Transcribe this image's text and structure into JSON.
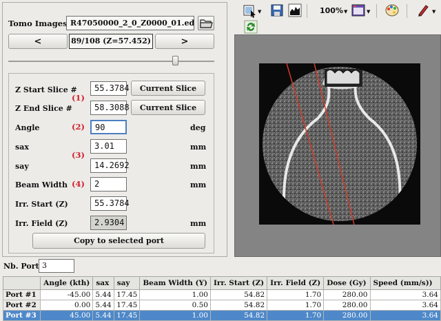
{
  "tomo": {
    "label": "Tomo Images",
    "file": "R47050000_2_0_Z0000_01.edf",
    "prev_label": "<",
    "next_label": ">",
    "slice_position": "89/108 (Z=57.452)",
    "slider_fraction": 0.82
  },
  "form": {
    "z_start": {
      "label": "Z Start Slice #",
      "value": "55.3784",
      "button": "Current Slice"
    },
    "z_end": {
      "label": "Z End Slice #",
      "value": "58.3088",
      "button": "Current Slice"
    },
    "group1": "(1)",
    "angle": {
      "label": "Angle",
      "value": "90",
      "unit": "deg",
      "marker": "(2)"
    },
    "sax": {
      "label": "sax",
      "value": "3.01",
      "unit": "mm"
    },
    "say": {
      "label": "say",
      "value": "14.2692",
      "unit": "mm"
    },
    "group3": "(3)",
    "beam_width": {
      "label": "Beam Width",
      "value": "2",
      "unit": "mm",
      "marker": "(4)"
    },
    "irr_start": {
      "label": "Irr. Start (Z)",
      "value": "55.3784"
    },
    "irr_field": {
      "label": "Irr. Field (Z)",
      "value": "2.9304",
      "unit": "mm"
    },
    "copy_button": "Copy to selected port"
  },
  "toolbar": {
    "zoom": "100%",
    "icons": [
      "select-tool-icon",
      "save-icon",
      "histogram-icon",
      "window-icon",
      "palette-icon",
      "pen-icon",
      "refresh-icon"
    ]
  },
  "colors": {
    "accent_red": "#d0202a",
    "selection_blue": "#4e88c9",
    "beam_line": "#d23a2a"
  },
  "nb_port": {
    "label": "Nb. Port",
    "value": "3"
  },
  "ports": {
    "columns": [
      "",
      "Angle (kth)",
      "sax",
      "say",
      "Beam Width (Y)",
      "Irr. Start (Z)",
      "Irr. Field (Z)",
      "Dose (Gy)",
      "Speed (mm/s))"
    ],
    "rows": [
      {
        "name": "Port #1",
        "cells": [
          "-45.00",
          "5.44",
          "17.45",
          "1.00",
          "54.82",
          "1.70",
          "280.00",
          "3.64"
        ],
        "selected": false
      },
      {
        "name": "Port #2",
        "cells": [
          "0.00",
          "5.44",
          "17.45",
          "0.50",
          "54.82",
          "1.70",
          "280.00",
          "3.64"
        ],
        "selected": false
      },
      {
        "name": "Port #3",
        "cells": [
          "45.00",
          "5.44",
          "17.45",
          "1.00",
          "54.82",
          "1.70",
          "280.00",
          "3.64"
        ],
        "selected": true
      }
    ]
  }
}
